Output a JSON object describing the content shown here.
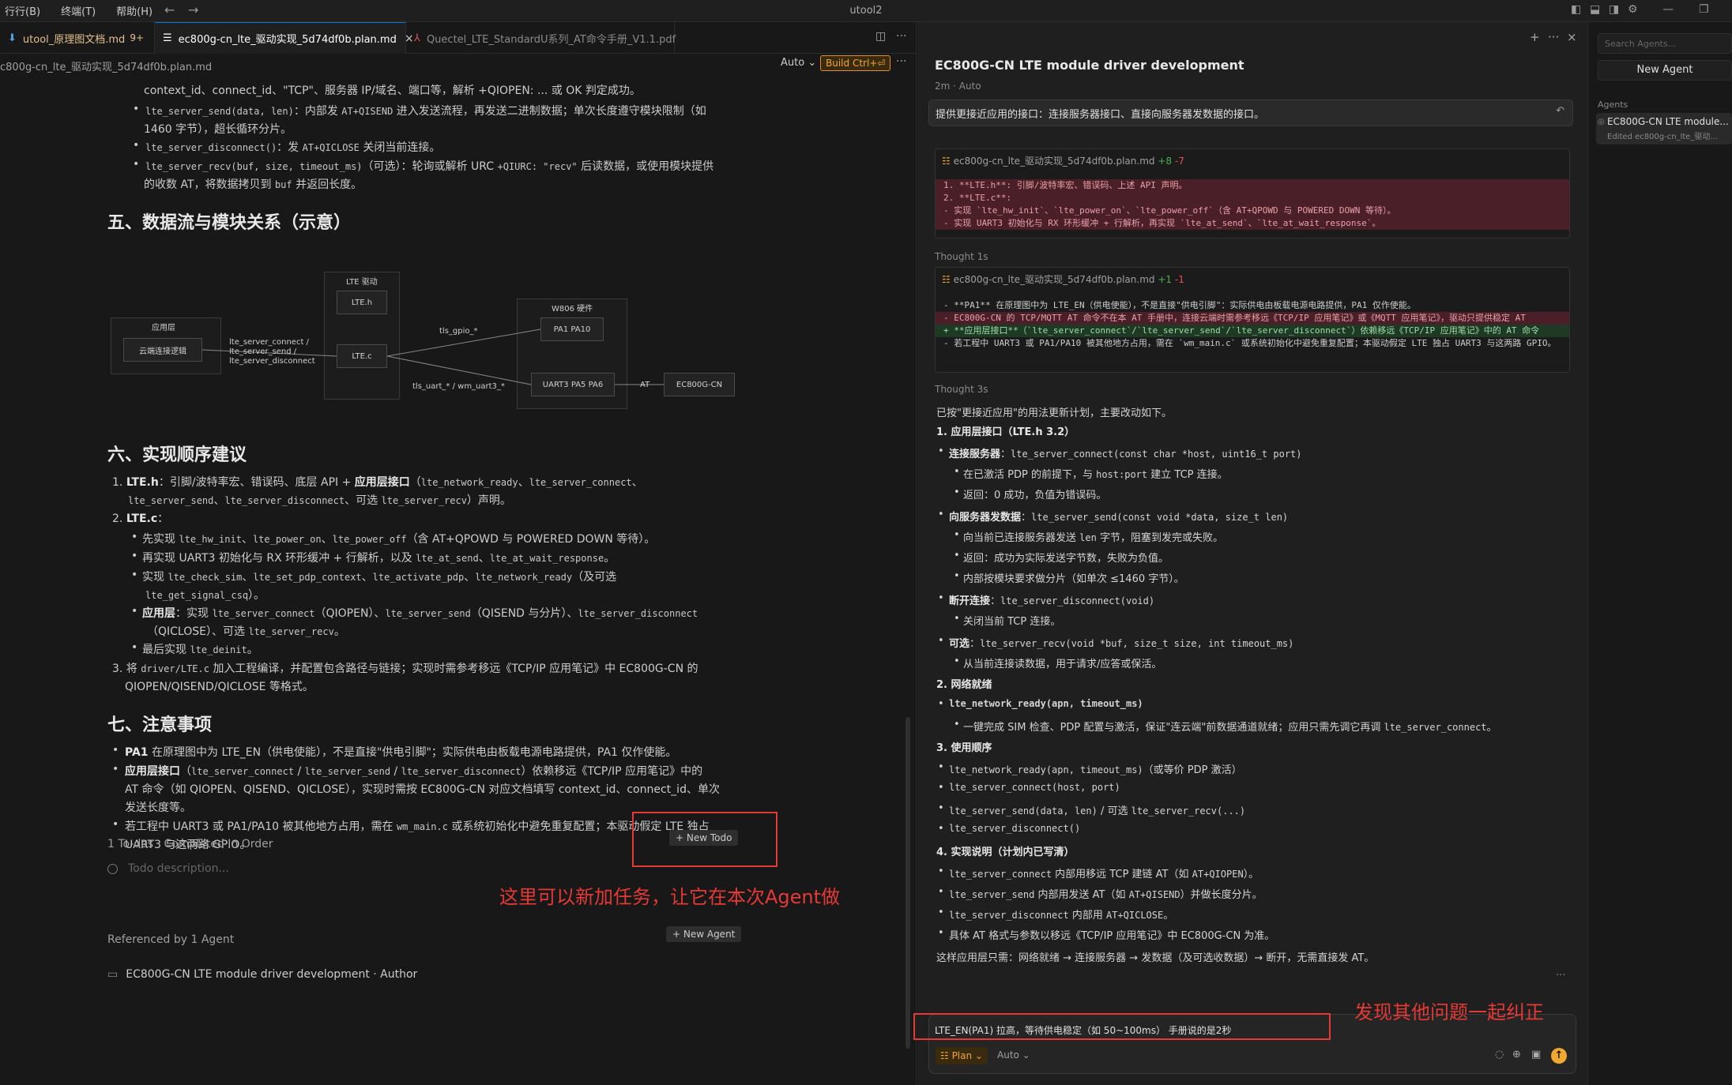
{
  "menu": [
    "行行(B)",
    "终端(T)",
    "帮助(H)"
  ],
  "app_title": "utool2",
  "tabs": [
    {
      "label": "utool_原理图文档.md",
      "badge": "9+",
      "icon": "⬇"
    },
    {
      "label": "ec800g-cn_lte_驱动实现_5d74df0b.plan.md",
      "icon": "☰",
      "close": "×"
    },
    {
      "label": "Quectel_LTE_StandardU系列_AT命令手册_V1.1.pdf",
      "icon": "⅄"
    }
  ],
  "breadcrumb": "c800g-cn_lte_驱动实现_5d74df0b.plan.md",
  "editor_toolbar": {
    "auto": "Auto ⌄",
    "build": "Build Ctrl+⏎",
    "more": "···"
  },
  "doc": {
    "top_lines": [
      "context_id、connect_id、\"TCP\"、服务器 IP/域名、端口等，解析 +QIOPEN: ... 或 OK 判定成功。",
      "lte_server_send(data, len)：内部发 AT+QISEND 进入发送流程，再发送二进制数据；单次长度遵守模块限制（如",
      "1460 字节），超长循环分片。",
      "lte_server_disconnect()：发 AT+QICLOSE 关闭当前连接。",
      "lte_server_recv(buf, size, timeout_ms)（可选）：轮询或解析 URC +QIURC: \"recv\" 后读数据，或使用模块提供",
      "的收数 AT，将数据拷贝到 buf 并返回长度。"
    ],
    "h5": "五、数据流与模块关系（示意）",
    "diagram": {
      "group_app": "应用层",
      "node_app": "云端连接逻辑",
      "group_driver": "LTE 驱动",
      "node_lte_h": "LTE.h",
      "node_lte_c": "LTE.c",
      "group_hw": "W806 硬件",
      "node_pa": "PA1 PA10",
      "node_uart": "UART3 PA5 PA6",
      "node_module": "EC800G-CN",
      "edge_api": [
        "lte_server_connect /",
        "lte_server_send /",
        "lte_server_disconnect"
      ],
      "edge_gpio": "tls_gpio_*",
      "edge_uart": "tls_uart_* / wm_uart3_*",
      "edge_at": "AT"
    },
    "h6": "六、实现顺序建议",
    "h7": "七、注意事项"
  },
  "todo": {
    "header": "1 To-dos · Completed In Order",
    "new_todo": "+ New Todo",
    "placeholder": "Todo description...",
    "annotation": "这里可以新加任务，让它在本次Agent做"
  },
  "referenced": {
    "header": "Referenced by 1 Agent",
    "new_agent": "+ New Agent",
    "agent": "EC800G-CN LTE module driver development · Author"
  },
  "chat": {
    "title": "EC800G-CN LTE module driver development",
    "meta": "2m · Auto",
    "sticky": "提供更接近应用的接口：连接服务器接口、直接向服务器发数据的接口。",
    "diff1": {
      "file": "ec800g-cn_lte_驱动实现_5d74df0b.plan.md",
      "add": "+8",
      "del": "-7",
      "lines": [
        "1. **LTE.h**: 引脚/波特率宏、错误码、上述 API 声明。",
        "2. **LTE.c**:",
        "   - 实现 `lte_hw_init`、`lte_power_on`、`lte_power_off`（含 AT+QPOWD 与 POWERED DOWN 等待）。",
        "   - 实现 UART3 初始化与 RX 环形缓冲 + 行解析，再实现 `lte_at_send`、`lte_at_wait_response`。"
      ]
    },
    "thought1": "Thought 1s",
    "diff2": {
      "file": "ec800g-cn_lte_驱动实现_5d74df0b.plan.md",
      "add": "+1",
      "del": "-1",
      "lines": [
        "- **PA1** 在原理图中为 LTE_EN（供电使能），不是直接\"供电引脚\"：实际供电由板载电源电路提供，PA1 仅作使能。",
        "- EC800G-CN 的 TCP/MQTT AT 命令不在本 AT 手册中，连接云端时需参考移远《TCP/IP 应用笔记》或《MQTT 应用笔记》，驱动只提供稳定 AT",
        "+ **应用层接口**（`lte_server_connect`/`lte_server_send`/`lte_server_disconnect`）依赖移远《TCP/IP 应用笔记》中的 AT 命令",
        "- 若工程中 UART3 或 PA1/PA10 被其他地方占用，需在 `wm_main.c` 或系统初始化中避免重复配置；本驱动假定 LTE 独占 UART3 与这两路 GPIO。"
      ]
    },
    "thought2": "Thought 3s",
    "summary_intro": "已按\"更接近应用\"的用法更新计划，主要改动如下。",
    "summary_outro": "这样应用层只需：网络就绪 → 连接服务器 → 发数据（及可选收数据）→ 断开，无需直接发 AT。",
    "input_text": "LTE_EN(PA1) 拉高，等待供电稳定（如 50~100ms） 手册说的是2秒",
    "plan_chip": "☷ Plan ⌄",
    "auto_chip": "Auto ⌄",
    "annotation": "发现其他问题一起纠正"
  },
  "agents_sidebar": {
    "search_placeholder": "Search Agents...",
    "new_agent": "New Agent",
    "section": "Agents",
    "item_title": "EC800G-CN LTE module...",
    "item_sub": "Edited ec800g-cn_lte_驱动..."
  }
}
